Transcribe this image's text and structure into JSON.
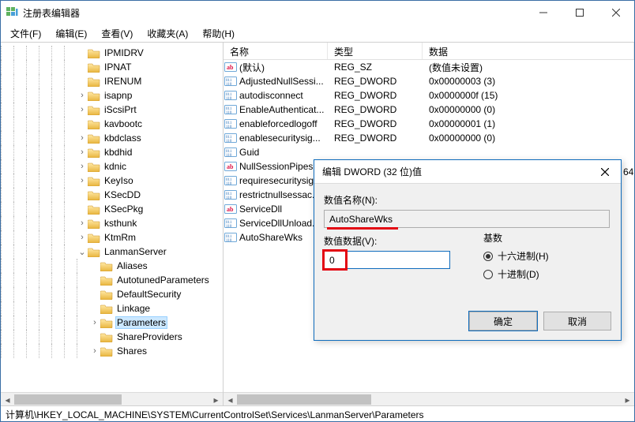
{
  "window": {
    "title": "注册表编辑器",
    "statusbar": "计算机\\HKEY_LOCAL_MACHINE\\SYSTEM\\CurrentControlSet\\Services\\LanmanServer\\Parameters"
  },
  "menu": {
    "file": "文件(F)",
    "edit": "编辑(E)",
    "view": "查看(V)",
    "fav": "收藏夹(A)",
    "help": "帮助(H)"
  },
  "tree": {
    "items": [
      {
        "label": "IPMIDRV",
        "exp": "",
        "depth": 6
      },
      {
        "label": "IPNAT",
        "exp": "",
        "depth": 6
      },
      {
        "label": "IRENUM",
        "exp": "",
        "depth": 6
      },
      {
        "label": "isapnp",
        "exp": ">",
        "depth": 6
      },
      {
        "label": "iScsiPrt",
        "exp": ">",
        "depth": 6
      },
      {
        "label": "kavbootc",
        "exp": "",
        "depth": 6
      },
      {
        "label": "kbdclass",
        "exp": ">",
        "depth": 6
      },
      {
        "label": "kbdhid",
        "exp": ">",
        "depth": 6
      },
      {
        "label": "kdnic",
        "exp": ">",
        "depth": 6
      },
      {
        "label": "KeyIso",
        "exp": ">",
        "depth": 6
      },
      {
        "label": "KSecDD",
        "exp": "",
        "depth": 6
      },
      {
        "label": "KSecPkg",
        "exp": "",
        "depth": 6
      },
      {
        "label": "ksthunk",
        "exp": ">",
        "depth": 6
      },
      {
        "label": "KtmRm",
        "exp": ">",
        "depth": 6
      },
      {
        "label": "LanmanServer",
        "exp": "v",
        "depth": 6
      },
      {
        "label": "Aliases",
        "exp": "",
        "depth": 7
      },
      {
        "label": "AutotunedParameters",
        "exp": "",
        "depth": 7
      },
      {
        "label": "DefaultSecurity",
        "exp": "",
        "depth": 7
      },
      {
        "label": "Linkage",
        "exp": "",
        "depth": 7
      },
      {
        "label": "Parameters",
        "exp": ">",
        "depth": 7,
        "selected": true
      },
      {
        "label": "ShareProviders",
        "exp": "",
        "depth": 7
      },
      {
        "label": "Shares",
        "exp": ">",
        "depth": 7
      }
    ]
  },
  "list": {
    "headers": {
      "name": "名称",
      "type": "类型",
      "data": "数据"
    },
    "rows": [
      {
        "icon": "ab",
        "name": "(默认)",
        "type": "REG_SZ",
        "data": "(数值未设置)"
      },
      {
        "icon": "bin",
        "name": "AdjustedNullSessi...",
        "type": "REG_DWORD",
        "data": "0x00000003 (3)"
      },
      {
        "icon": "bin",
        "name": "autodisconnect",
        "type": "REG_DWORD",
        "data": "0x0000000f (15)"
      },
      {
        "icon": "bin",
        "name": "EnableAuthenticat...",
        "type": "REG_DWORD",
        "data": "0x00000000 (0)"
      },
      {
        "icon": "bin",
        "name": "enableforcedlogoff",
        "type": "REG_DWORD",
        "data": "0x00000001 (1)"
      },
      {
        "icon": "bin",
        "name": "enablesecuritysig...",
        "type": "REG_DWORD",
        "data": "0x00000000 (0)"
      },
      {
        "icon": "bin",
        "name": "Guid",
        "type": "",
        "data": ""
      },
      {
        "icon": "ab",
        "name": "NullSessionPipes",
        "type": "",
        "data": ""
      },
      {
        "icon": "bin",
        "name": "requiresecuritysig...",
        "type": "",
        "data": ""
      },
      {
        "icon": "bin",
        "name": "restrictnullsessac...",
        "type": "",
        "data": ""
      },
      {
        "icon": "ab",
        "name": "ServiceDll",
        "type": "",
        "data": ""
      },
      {
        "icon": "bin",
        "name": "ServiceDllUnload...",
        "type": "",
        "data": ""
      },
      {
        "icon": "bin",
        "name": "AutoShareWks",
        "type": "",
        "data": ""
      }
    ],
    "extra_right": "64"
  },
  "dialog": {
    "title": "编辑 DWORD (32 位)值",
    "name_label": "数值名称(N):",
    "name_value": "AutoShareWks",
    "data_label": "数值数据(V):",
    "data_value": "0",
    "radix_label": "基数",
    "radix_hex": "十六进制(H)",
    "radix_dec": "十进制(D)",
    "ok": "确定",
    "cancel": "取消"
  }
}
